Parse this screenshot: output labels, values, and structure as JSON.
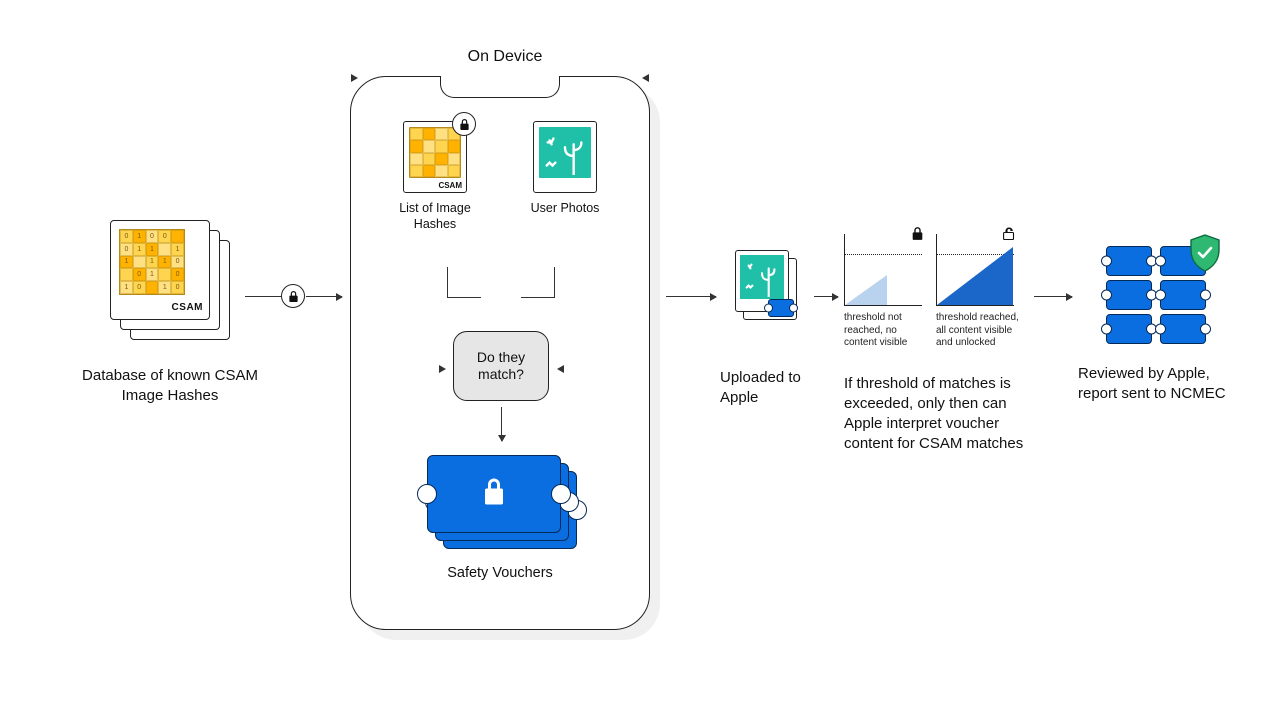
{
  "stage_db": {
    "caption": "Database of known CSAM Image Hashes",
    "tag": "CSAM"
  },
  "phone": {
    "title": "On Device",
    "hashes": {
      "label": "List of Image Hashes",
      "tag": "CSAM"
    },
    "photos": {
      "label": "User Photos"
    },
    "match_question": "Do they match?",
    "vouchers_label": "Safety Vouchers"
  },
  "stage_upload": {
    "caption": "Uploaded to Apple"
  },
  "stage_threshold": {
    "chart_a": "threshold not reached, no content visible",
    "chart_b": "threshold reached, all content visible and unlocked",
    "caption": "If threshold of matches is exceeded, only then can Apple interpret voucher content for CSAM matches"
  },
  "stage_review": {
    "caption": "Reviewed by Apple, report sent to NCMEC"
  },
  "colors": {
    "blue": "#0a6ee0",
    "blue_dark": "#062a57",
    "green": "#1fbfa8",
    "shield_green": "#2eb872",
    "orange1": "#ffd54f",
    "orange2": "#ffb300",
    "orange3": "#ffe082"
  }
}
